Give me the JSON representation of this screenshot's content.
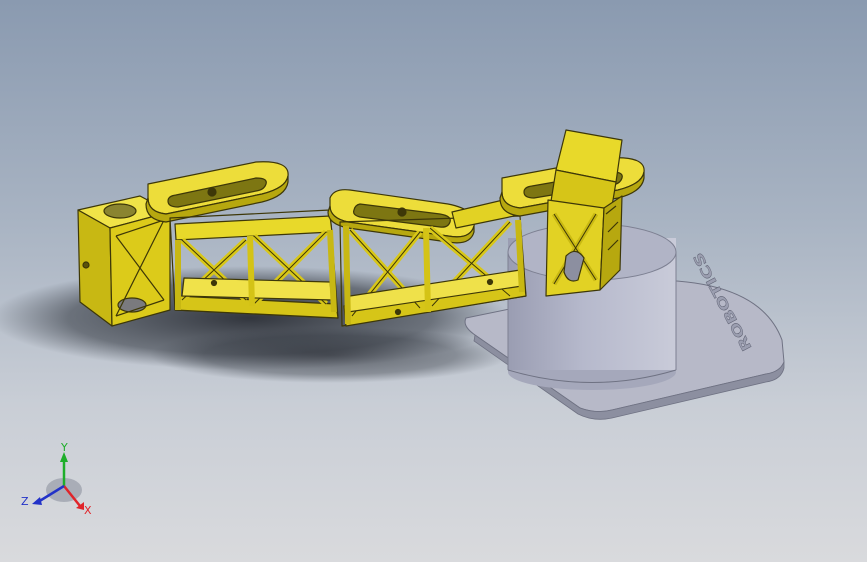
{
  "app": {
    "window_title": ""
  },
  "model": {
    "base_engraving": "ROBOTICS",
    "arm_color": "#e5d41e",
    "arm_shadow_color": "#a89a10",
    "base_color": "#b9bccb",
    "base_shadow_color": "#8f93a4",
    "background_top": "#8a9ab0",
    "background_bottom": "#d9dadd"
  },
  "triad": {
    "x_label": "X",
    "y_label": "Y",
    "z_label": "Z",
    "x_color": "#e0242a",
    "y_color": "#1eae2a",
    "z_color": "#2232c8"
  }
}
